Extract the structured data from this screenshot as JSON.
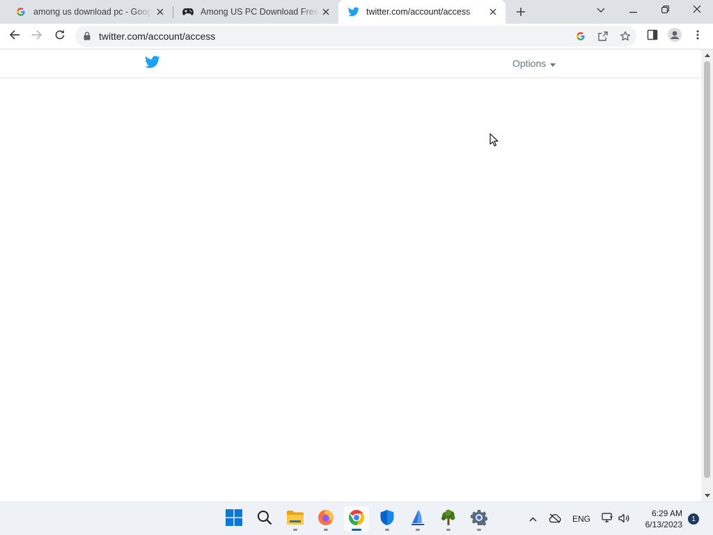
{
  "browser": {
    "tabs": [
      {
        "title": "among us download pc - Google",
        "icon": "google-icon",
        "active": false
      },
      {
        "title": "Among US PC Download Free Ga",
        "icon": "gamepad-icon",
        "active": false
      },
      {
        "title": "twitter.com/account/access",
        "icon": "twitter-bird-icon",
        "active": true
      }
    ],
    "address": {
      "url": "twitter.com/account/access"
    }
  },
  "page": {
    "options_label": "Options",
    "brand_color": "#1DA1F2"
  },
  "taskbar": {
    "apps": [
      {
        "name": "start",
        "icon": "windows-start-icon"
      },
      {
        "name": "search",
        "icon": "search-icon"
      },
      {
        "name": "file-explorer",
        "icon": "folder-icon"
      },
      {
        "name": "firefox",
        "icon": "firefox-icon"
      },
      {
        "name": "chrome",
        "icon": "chrome-icon",
        "active": true
      },
      {
        "name": "security",
        "icon": "shield-icon"
      },
      {
        "name": "app-blue",
        "icon": "sail-icon"
      },
      {
        "name": "app-tree",
        "icon": "tree-icon"
      },
      {
        "name": "settings",
        "icon": "gear-icon"
      }
    ],
    "language": "ENG",
    "time": "6:29 AM",
    "date": "6/13/2023",
    "notification_count": "1"
  }
}
